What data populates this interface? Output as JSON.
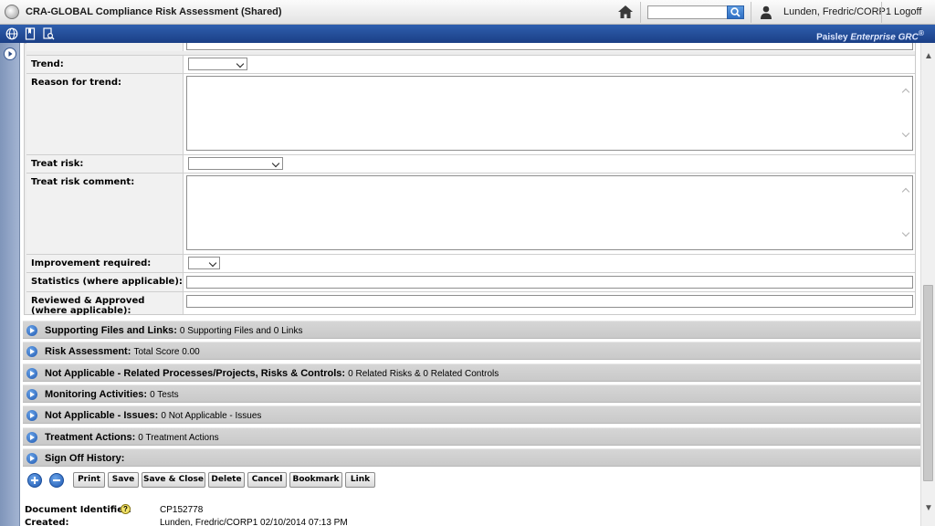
{
  "window": {
    "title": "CRA-GLOBAL Compliance Risk Assessment (Shared)",
    "search_placeholder": "",
    "user": "Lunden, Fredric/CORP1",
    "logoff_label": "Logoff"
  },
  "branding": {
    "name": "Paisley",
    "product": "Enterprise GRC",
    "mark": "®"
  },
  "form": {
    "trend_label": "Trend:",
    "reason_label": "Reason for trend:",
    "treat_risk_label": "Treat risk:",
    "treat_comment_label": "Treat risk comment:",
    "improvement_label": "Improvement required:",
    "statistics_label": "Statistics (where applicable):",
    "reviewed_label": "Reviewed & Approved (where applicable):"
  },
  "sections": [
    {
      "title": "Supporting Files and Links",
      "info": "0 Supporting Files and 0 Links"
    },
    {
      "title": "Risk Assessment",
      "info": "Total Score 0.00"
    },
    {
      "title": "Not Applicable - Related Processes/Projects, Risks & Controls",
      "info": "0 Related Risks & 0 Related Controls"
    },
    {
      "title": "Monitoring Activities",
      "info": "0  Tests"
    },
    {
      "title": "Not Applicable - Issues",
      "info": "0  Not Applicable - Issues"
    },
    {
      "title": "Treatment Actions",
      "info": "0  Treatment Actions"
    },
    {
      "title": "Sign Off History",
      "info": ""
    }
  ],
  "buttons": {
    "print": "Print",
    "save": "Save",
    "save_close": "Save & Close",
    "delete": "Delete",
    "cancel": "Cancel",
    "bookmark": "Bookmark",
    "link": "Link"
  },
  "meta": {
    "doc_id_label": "Document Identifier:",
    "doc_id": "CP152778",
    "created_label": "Created:",
    "created": "Lunden, Fredric/CORP1 02/10/2014 07:13 PM",
    "help_glyph": "?"
  },
  "colors": {
    "toolbar_blue": "#1b3f86",
    "section_gray": "#cfcfcf",
    "accent_blue": "#1f58b0"
  }
}
